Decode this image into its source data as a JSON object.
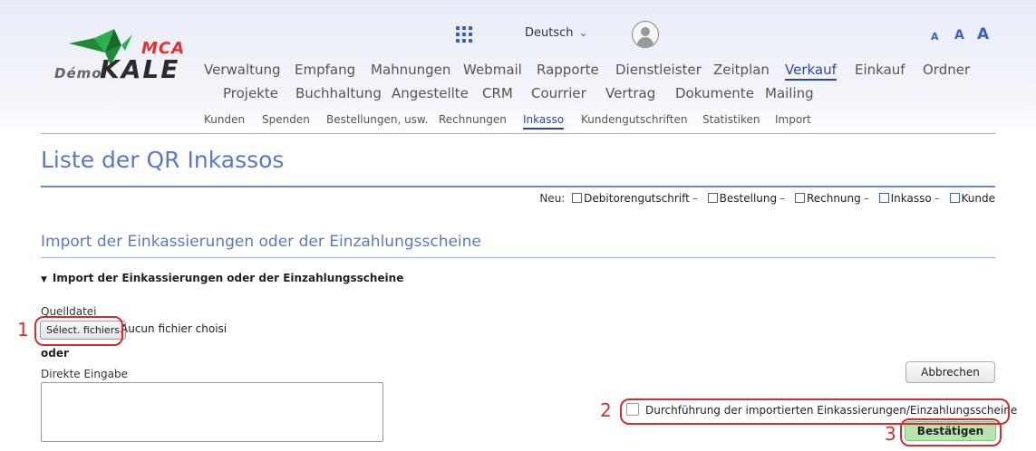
{
  "logo": {
    "demo": "Démo",
    "kale": "KALE",
    "mca": "MCA"
  },
  "header": {
    "language": "Deutsch",
    "font_sizes": [
      "A",
      "A",
      "A"
    ]
  },
  "menu_row1": [
    "Verwaltung",
    "Empfang",
    "Mahnungen",
    "Webmail",
    "Rapporte",
    "Dienstleister",
    "Zeitplan",
    "Verkauf",
    "Einkauf",
    "Ordner"
  ],
  "menu_row2": [
    "Projekte",
    "Buchhaltung",
    "Angestellte",
    "CRM",
    "Courrier",
    "Vertrag",
    "Dokumente",
    "Mailing"
  ],
  "submenu": [
    "Kunden",
    "Spenden",
    "Bestellungen, usw.",
    "Rechnungen",
    "Inkasso",
    "Kundengutschriften",
    "Statistiken",
    "Import"
  ],
  "page": {
    "title": "Liste der QR Inkassos",
    "new_label": "Neu:",
    "new_links": [
      "Debitorengutschrift",
      "Bestellung",
      "Rechnung",
      "Inkasso",
      "Kunde"
    ],
    "section_title": "Import der Einkassierungen oder der Einzahlungsscheine",
    "details_title": "Import der Einkassierungen oder der Einzahlungsscheine",
    "source_label": "Quelldatei",
    "file_button": "Sélect. fichiers",
    "file_status": "Aucun fichier choisi",
    "or_label": "oder",
    "direct_label": "Direkte Eingabe",
    "cancel": "Abbrechen",
    "execute_label": "Durchführung der importierten Einkassierungen/Einzahlungsscheine",
    "confirm": "Bestätigen"
  },
  "annotations": [
    "1",
    "2",
    "3"
  ],
  "colors": {
    "accent": "#2b45a8",
    "title": "#5a78c9",
    "annotation": "#d82c2c",
    "confirm_bg": "#b8e4b0"
  }
}
